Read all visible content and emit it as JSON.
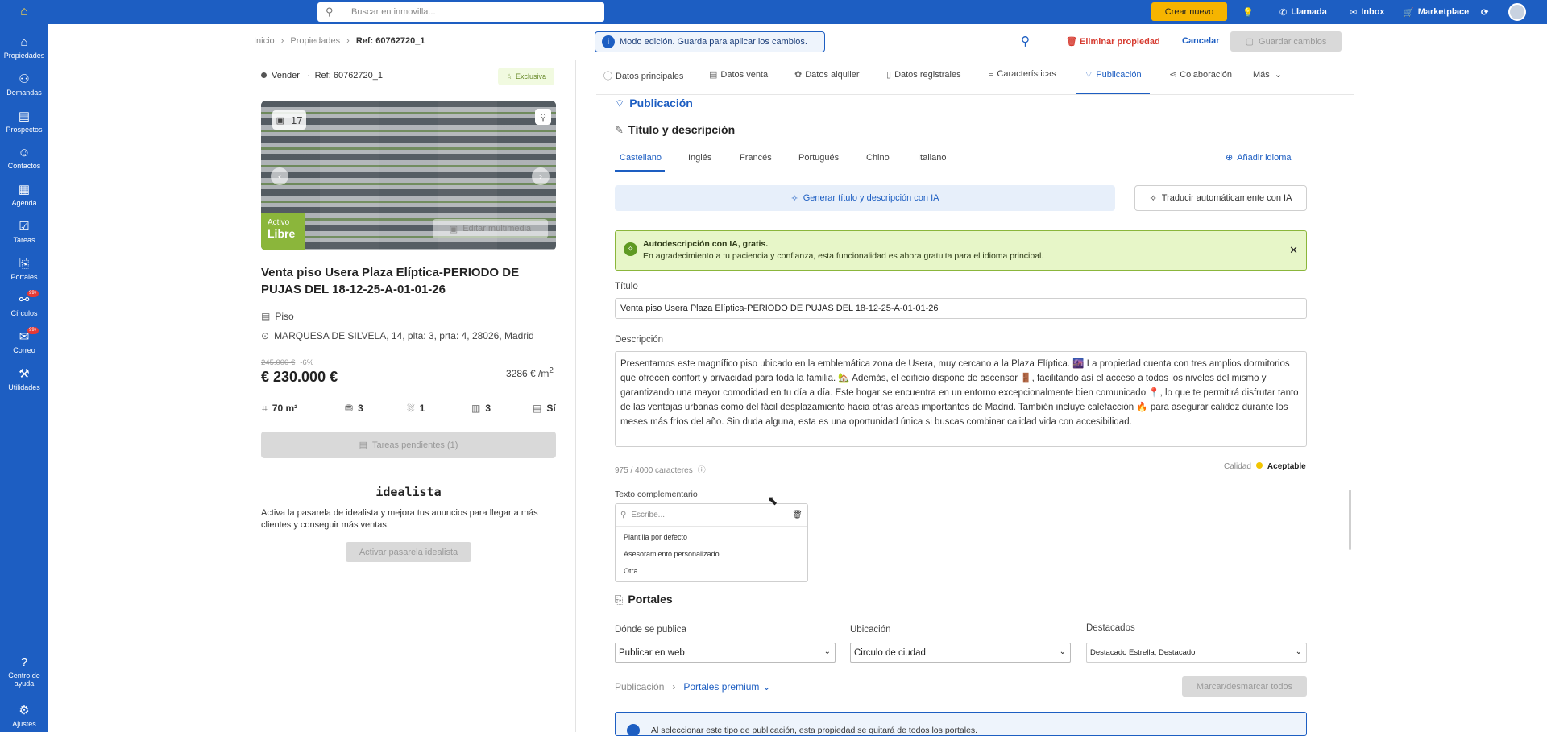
{
  "topbar": {
    "search_placeholder": "Buscar en inmovilla...",
    "crear_label": "Crear nuevo",
    "nav": [
      {
        "icon": "phone-icon",
        "label": "Llamada"
      },
      {
        "icon": "inbox-icon",
        "label": "Inbox"
      },
      {
        "icon": "cart-icon",
        "label": "Marketplace"
      }
    ]
  },
  "sidebar": {
    "items": [
      {
        "label": "Propiedades",
        "icon": "home-icon"
      },
      {
        "label": "Demandas",
        "icon": "users-icon"
      },
      {
        "label": "Prospectos",
        "icon": "list-icon"
      },
      {
        "label": "Contactos",
        "icon": "contact-icon"
      },
      {
        "label": "Agenda",
        "icon": "calendar-icon"
      },
      {
        "label": "Tareas",
        "icon": "tasks-icon"
      },
      {
        "label": "Portales",
        "icon": "portal-icon"
      },
      {
        "label": "Círculos",
        "icon": "circles-icon",
        "badge": "99+"
      },
      {
        "label": "Correo",
        "icon": "mail-icon",
        "badge": "99+"
      },
      {
        "label": "Utilidades",
        "icon": "tools-icon"
      }
    ],
    "help_label_1": "Centro de",
    "help_label_2": "ayuda",
    "settings_label": "Ajustes"
  },
  "header": {
    "breadcrumb": [
      "Inicio",
      "Propiedades",
      "Ref: 60762720_1"
    ],
    "edit_mode": "Modo edición. Guarda para aplicar los cambios.",
    "delete_label": "Eliminar propiedad",
    "cancel_label": "Cancelar",
    "save_label": "Guardar cambios"
  },
  "property": {
    "operation": "Vender",
    "ref": "Ref: 60762720_1",
    "exclusive": "Exclusiva",
    "photo_count": "17",
    "status_small": "Activo",
    "status_big": "Libre",
    "edit_media": "Editar multimedia",
    "title": "Venta piso Usera Plaza Elíptica-PERIODO DE PUJAS DEL 18-12-25-A-01-01-26",
    "type": "Piso",
    "address": "MARQUESA DE SILVELA, 14, plta: 3, prta: 4, 28026, Madrid",
    "old_price": "245.000 €",
    "discount": "-6%",
    "price": "€ 230.000 €",
    "price_m2": "3286 € /m",
    "price_m2_sup": "2",
    "features": {
      "area": "70 m²",
      "rooms": "3",
      "baths": "1",
      "floors": "3",
      "extra": "Sí"
    },
    "tasks_btn": "Tareas pendientes (1)"
  },
  "idealista": {
    "brand": "idealista",
    "text": "Activa la pasarela de idealista y mejora tus anuncios para llegar a más clientes y conseguir más ventas.",
    "button": "Activar pasarela idealista"
  },
  "tabs": [
    {
      "label": "Datos principales",
      "icon": "ⓘ"
    },
    {
      "label": "Datos venta",
      "icon": "▤"
    },
    {
      "label": "Datos alquiler",
      "icon": "✿"
    },
    {
      "label": "Datos registrales",
      "icon": "▯"
    },
    {
      "label": "Características",
      "icon": "≡"
    },
    {
      "label": "Publicación",
      "icon": "ᵠ"
    },
    {
      "label": "Colaboración",
      "icon": "<"
    },
    {
      "label": "Más",
      "icon": ""
    }
  ],
  "publicacion": {
    "heading": "Publicación",
    "subheading": "Título y descripción",
    "languages": [
      "Castellano",
      "Inglés",
      "Francés",
      "Portugués",
      "Chino",
      "Italiano"
    ],
    "add_language": "Añadir idioma",
    "ai_generate": "Generar título y descripción con IA",
    "ai_translate": "Traducir automáticamente con IA",
    "banner_title": "Autodescripción con IA, gratis.",
    "banner_text": "En agradecimiento a tu paciencia y confianza, esta funcionalidad es ahora gratuita para el idioma principal.",
    "titulo_label": "Título",
    "titulo_value": "Venta piso Usera Plaza Elíptica-PERIODO DE PUJAS DEL 18-12-25-A-01-01-26",
    "descripcion_label": "Descripción",
    "descripcion_value": "Presentamos este magnífico piso ubicado en la emblemática zona de Usera, muy cercano a la Plaza Elíptica. 🌆 La propiedad cuenta con tres amplios dormitorios que ofrecen confort y privacidad para toda la familia. 🏡 Además, el edificio dispone de ascensor 🚪, facilitando así el acceso a todos los niveles del mismo y garantizando una mayor comodidad en tu día a día. Este hogar se encuentra en un entorno excepcionalmente bien comunicado 📍, lo que te permitirá disfrutar tanto de las ventajas urbanas como del fácil desplazamiento hacia otras áreas importantes de Madrid. También incluye calefacción 🔥 para asegurar calidez durante los meses más fríos del año. Sin duda alguna, esta es una oportunidad única si buscas combinar calidad vida con accesibilidad.",
    "char_count": "975 / 4000 caracteres",
    "quality_label": "Calidad",
    "quality_value": "Aceptable",
    "complementario_label": "Texto complementario",
    "complementario_placeholder": "Escribe...",
    "complementario_options": [
      "Plantilla por defecto",
      "Asesoramiento personalizado",
      "Otra"
    ]
  },
  "portales": {
    "heading": "Portales",
    "donde_label": "Dónde se publica",
    "donde_value": "Publicar en web",
    "ubicacion_label": "Ubicación",
    "ubicacion_value": "Circulo de ciudad",
    "destacados_label": "Destacados",
    "destacados_value": "Destacado Estrella, Destacado",
    "bread_a": "Publicación",
    "bread_b": "Portales premium",
    "marcar": "Marcar/desmarcar todos",
    "info": "Al seleccionar este tipo de publicación, esta propiedad se quitará de todos los portales."
  },
  "colors": {
    "brand": "#1d5ec2",
    "accent": "#f6b400",
    "success": "#8bb63b",
    "danger": "#d63b30"
  }
}
